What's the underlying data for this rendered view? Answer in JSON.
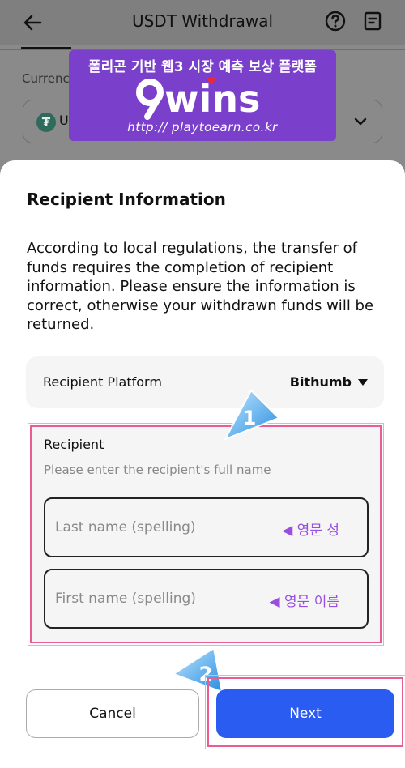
{
  "header": {
    "title": "USDT Withdrawal",
    "back_icon": "arrow-left-icon",
    "help_icon": "question-circle-icon",
    "records_icon": "document-icon"
  },
  "background_form": {
    "currency_label": "Currency",
    "currency_value": "USDT"
  },
  "watermark": {
    "tagline": "폴리곤 기반 웹3 시장 예측 보상 플랫폼",
    "logo_text": "9wins",
    "url": "http:// playtoearn.co.kr"
  },
  "sheet": {
    "title": "Recipient Information",
    "description": "According to local regulations, the transfer of funds requires the completion of recipient information. Please ensure the information is correct, otherwise your withdrawn funds will be returned.",
    "platform": {
      "label": "Recipient Platform",
      "value": "Bithumb"
    },
    "recipient": {
      "label": "Recipient",
      "hint": "Please enter the recipient's full name",
      "last_name_placeholder": "Last name (spelling)",
      "last_name_annotation": "◀ 영문 성",
      "first_name_placeholder": "First name (spelling)",
      "first_name_annotation": "◀ 영문 이름"
    },
    "buttons": {
      "cancel": "Cancel",
      "next": "Next"
    }
  },
  "badges": [
    "1",
    "2"
  ],
  "colors": {
    "accent_blue": "#2a5cf2",
    "highlight_pink": "#e95d93",
    "watermark_purple": "#7a40cc",
    "annotation_purple": "#9b4de0"
  }
}
